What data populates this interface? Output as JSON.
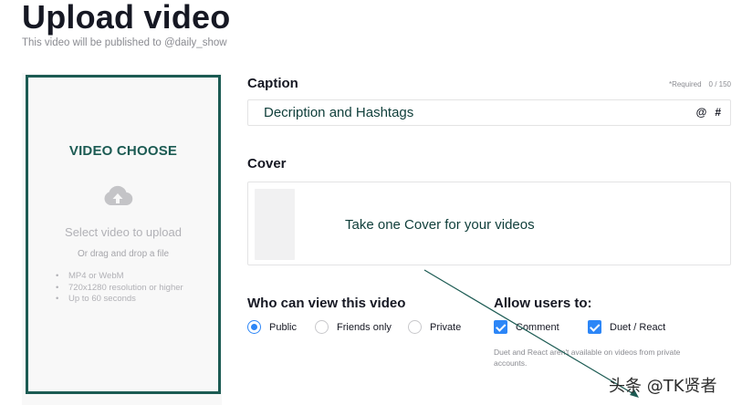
{
  "header": {
    "title": "Upload video",
    "subtitle": "This video will be published to @daily_show"
  },
  "upload": {
    "annotation": "VIDEO CHOOSE",
    "icon": "cloud-upload-icon",
    "select_text": "Select video to upload",
    "drag_text": "Or drag and drop a file",
    "requirements": [
      "MP4 or WebM",
      "720x1280 resolution or higher",
      "Up to 60 seconds"
    ]
  },
  "caption": {
    "label": "Caption",
    "required": "*Required",
    "count": "0 / 150",
    "value": "Decription and Hashtags",
    "mention_icon": "@",
    "hashtag_icon": "#"
  },
  "cover": {
    "label": "Cover",
    "annotation": "Take one Cover for your videos"
  },
  "privacy": {
    "label": "Who can view this video",
    "options": [
      {
        "label": "Public",
        "checked": true
      },
      {
        "label": "Friends only",
        "checked": false
      },
      {
        "label": "Private",
        "checked": false
      }
    ]
  },
  "allow": {
    "label": "Allow users to:",
    "options": [
      {
        "label": "Comment",
        "checked": true
      },
      {
        "label": "Duet / React",
        "checked": true
      }
    ],
    "hint": "Duet and React aren't available on videos from private accounts."
  },
  "watermark": "头条 @TK贤者",
  "colors": {
    "accent": "#2c86f7",
    "annotation": "#1c5b53",
    "text": "#161823",
    "muted": "#8a8b91"
  }
}
